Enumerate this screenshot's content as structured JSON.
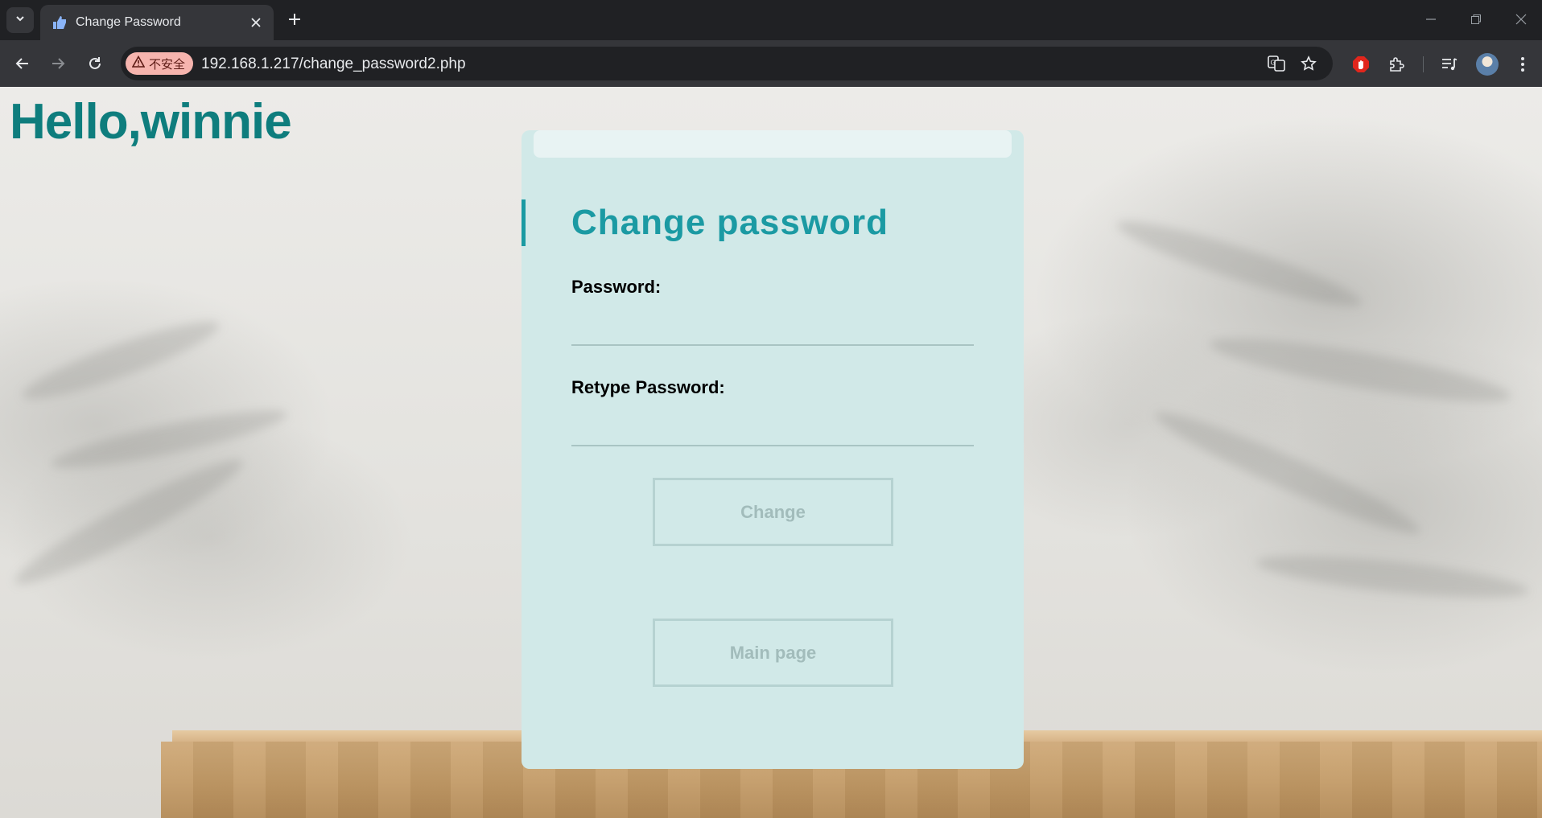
{
  "browser": {
    "tab_title": "Change Password",
    "security_label": "不安全",
    "url": "192.168.1.217/change_password2.php"
  },
  "page": {
    "greeting": "Hello,winnie",
    "form": {
      "title": "Change password",
      "password_label": "Password:",
      "password_value": "",
      "retype_label": "Retype Password:",
      "retype_value": "",
      "change_button": "Change",
      "main_page_button": "Main page"
    }
  },
  "colors": {
    "accent": "#1b9aa3",
    "greeting": "#0e7d7d",
    "card": "#d1e9e8"
  }
}
